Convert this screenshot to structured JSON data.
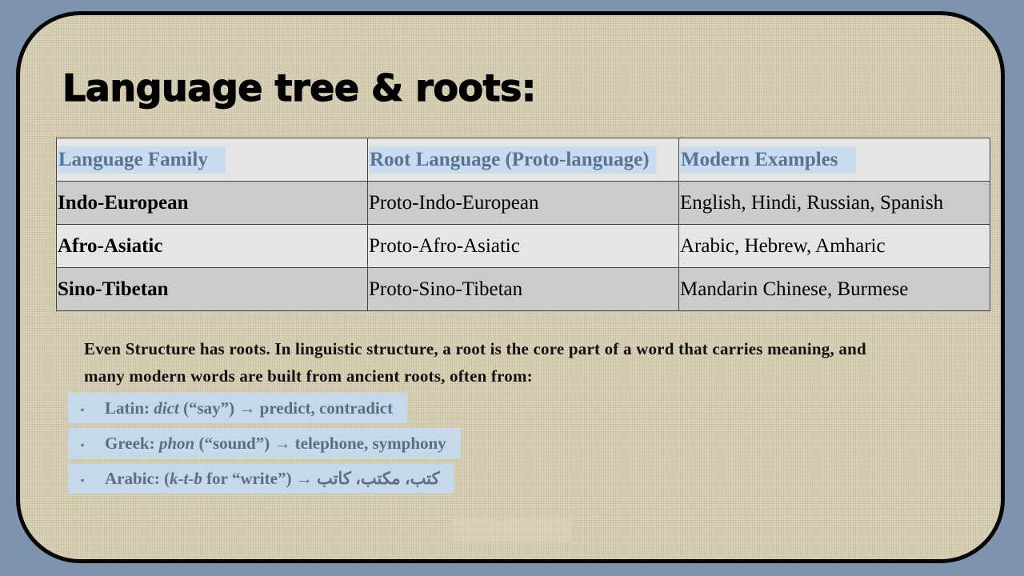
{
  "slide": {
    "title": "Language tree & roots:"
  },
  "table": {
    "headers": [
      "Language Family",
      "Root Language (Proto-language)",
      "Modern Examples"
    ],
    "rows": [
      [
        "Indo-European",
        "Proto-Indo-European",
        "English, Hindi, Russian, Spanish"
      ],
      [
        "Afro-Asiatic",
        "Proto-Afro-Asiatic",
        "Arabic, Hebrew, Amharic"
      ],
      [
        "Sino-Tibetan",
        "Proto-Sino-Tibetan",
        "Mandarin Chinese, Burmese"
      ]
    ]
  },
  "paragraph": "Even Structure has roots. In linguistic structure, a root is the core part of a word that carries meaning, and many modern words are built from ancient roots, often from:",
  "bullets": [
    {
      "marker": "▪",
      "prefix": "Latin: ",
      "root": "dict",
      "gloss": " (“say”) → predict, contradict"
    },
    {
      "marker": "▪",
      "prefix": "Greek: ",
      "root": "phon",
      "gloss": " (“sound”) → telephone, symphony"
    },
    {
      "marker": "▪",
      "prefix": "Arabic: (",
      "root": "k-t-b",
      "gloss": " for “write”) → كتب، مكتب، كاتب"
    }
  ],
  "colors": {
    "outer_background": "#7f93ae",
    "slide_background": "#d9d0b6",
    "header_text": "#5a7394",
    "highlight": "#c9dcee",
    "bullet_text": "#5a6e86"
  }
}
